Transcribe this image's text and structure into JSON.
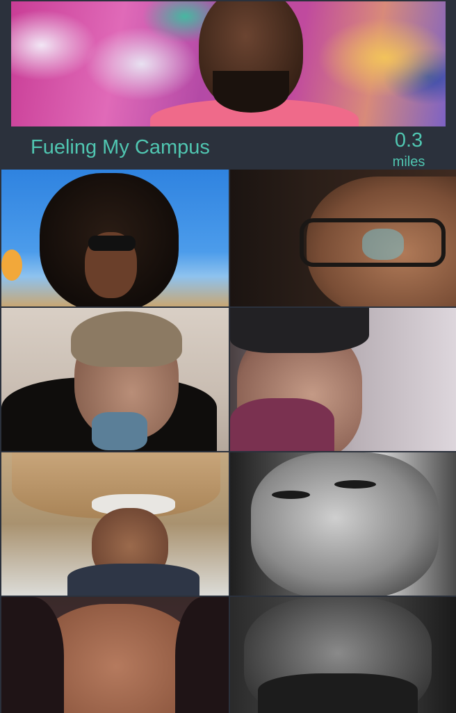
{
  "header": {
    "title": "Fueling My Campus",
    "distance_value": "0.3",
    "distance_unit": "miles"
  },
  "photos": [
    {
      "name": "curly-hair-sunglasses"
    },
    {
      "name": "woman-glasses"
    },
    {
      "name": "man-hand-on-face"
    },
    {
      "name": "man-beanie"
    },
    {
      "name": "woman-carrying-basket"
    },
    {
      "name": "man-bw-closeup"
    },
    {
      "name": "woman-closeup"
    },
    {
      "name": "man-bw-beard"
    }
  ]
}
